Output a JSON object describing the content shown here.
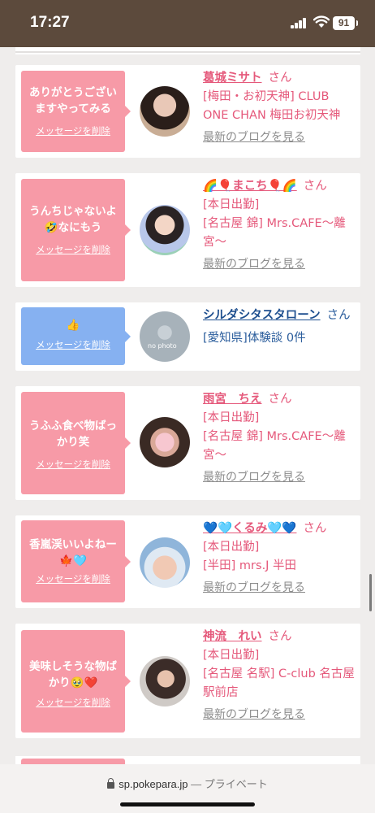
{
  "status": {
    "time": "17:27",
    "battery": "91"
  },
  "delete_label": "メッセージを削除",
  "blog_label": "最新のブログを見る",
  "san": "さん",
  "items": [
    {
      "message": "ありがとうございますやってみる",
      "name": "葛城ミサト",
      "lines": [
        "[梅田・お初天神] CLUB ONE CHAN 梅田お初天神"
      ]
    },
    {
      "message": "うんちじゃないよ🤣なにもう",
      "name": "🌈🎈まこち🎈🌈",
      "lines": [
        "[本日出勤]",
        "[名古屋 錦] Mrs.CAFE～離宮～"
      ]
    },
    {
      "message": "👍",
      "name": "シルダシタスタローン",
      "lines": [
        "[愛知県]体験談 0件"
      ],
      "avatar_text": "no photo"
    },
    {
      "message": "うふふ食べ物ばっかり笑",
      "name": "雨宮　ちえ",
      "lines": [
        "[本日出勤]",
        "[名古屋 錦] Mrs.CAFE～離宮～"
      ]
    },
    {
      "message": "香嵐渓いいよねー🍁🩵",
      "name": "💙🩵くるみ🩵💙",
      "lines": [
        "[本日出勤]",
        "[半田] mrs.J 半田"
      ]
    },
    {
      "message": "美味しそうな物ばかり🥹❤️",
      "name": "神流　れい",
      "lines": [
        "[本日出勤]",
        "[名古屋 名駅] C-club 名古屋駅前店"
      ]
    }
  ],
  "url_bar": {
    "domain": "sp.pokepara.jp",
    "mode": "— プライベート"
  },
  "colors": {
    "pink": "#f79aa7",
    "blue": "#86b1f1",
    "name_pink": "#e5597b",
    "name_blue": "#1e4f8f"
  }
}
